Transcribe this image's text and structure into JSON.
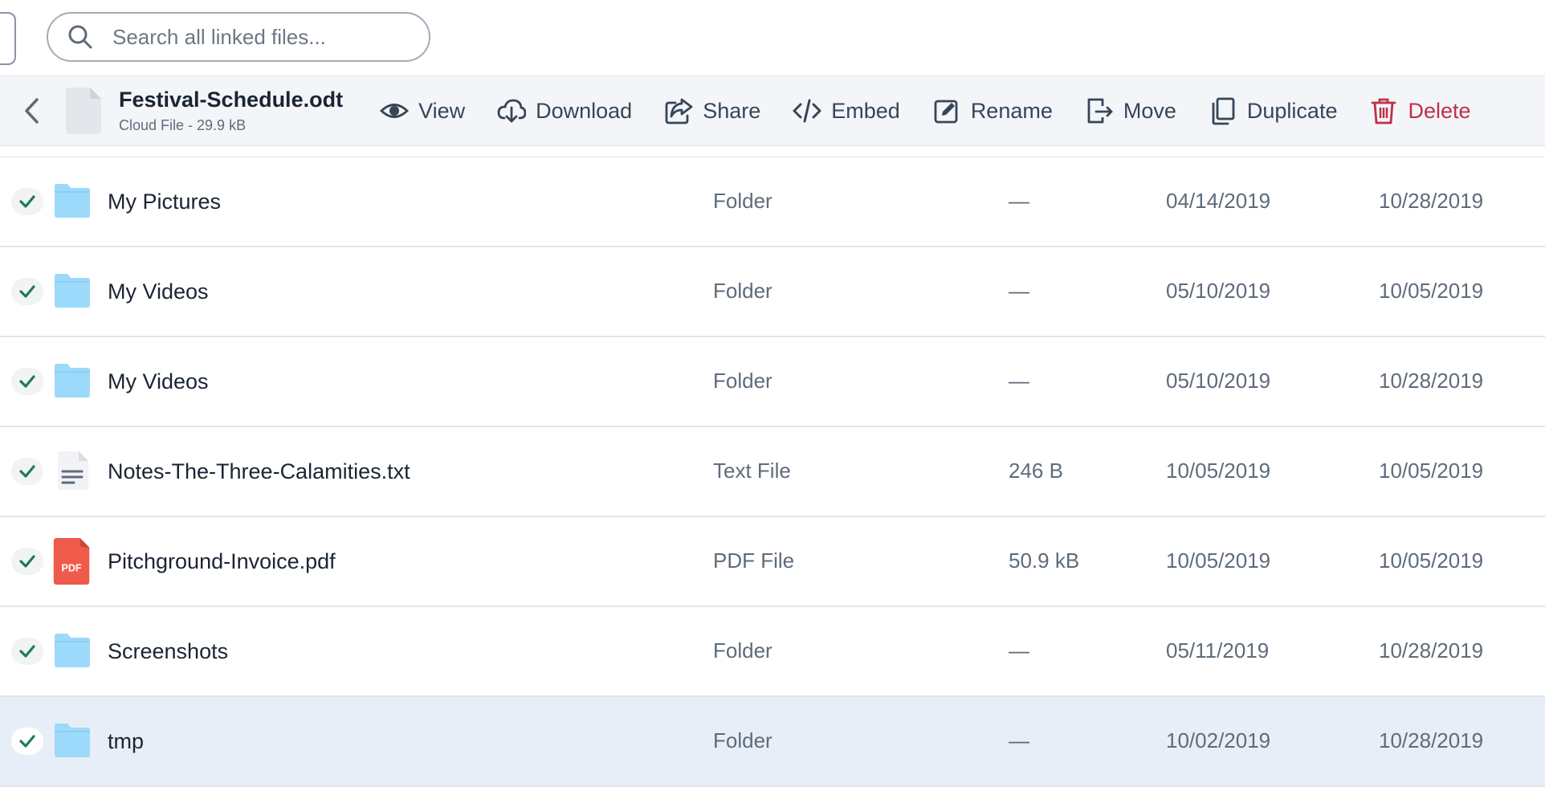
{
  "search": {
    "placeholder": "Search all linked files..."
  },
  "toolbar": {
    "file_name": "Festival-Schedule.odt",
    "file_meta": "Cloud File - 29.9 kB",
    "actions": {
      "view": "View",
      "download": "Download",
      "share": "Share",
      "embed": "Embed",
      "rename": "Rename",
      "move": "Move",
      "duplicate": "Duplicate",
      "delete": "Delete"
    }
  },
  "colors": {
    "accent": "#1f7a5a",
    "folder": "#9dd9fb",
    "pdf": "#ef5b4a",
    "delete": "#c03046",
    "selected_row": "#e8eef7"
  },
  "rows": [
    {
      "name": "My Pictures",
      "type": "Folder",
      "size": "—",
      "created": "04/14/2019",
      "modified": "10/28/2019",
      "icon": "folder-icon"
    },
    {
      "name": "My Videos",
      "type": "Folder",
      "size": "—",
      "created": "05/10/2019",
      "modified": "10/05/2019",
      "icon": "folder-icon"
    },
    {
      "name": "My Videos",
      "type": "Folder",
      "size": "—",
      "created": "05/10/2019",
      "modified": "10/28/2019",
      "icon": "folder-icon"
    },
    {
      "name": "Notes-The-Three-Calamities.txt",
      "type": "Text File",
      "size": "246 B",
      "created": "10/05/2019",
      "modified": "10/05/2019",
      "icon": "text-file-icon"
    },
    {
      "name": "Pitchground-Invoice.pdf",
      "type": "PDF File",
      "size": "50.9 kB",
      "created": "10/05/2019",
      "modified": "10/05/2019",
      "icon": "pdf-file-icon",
      "icon_label": "PDF"
    },
    {
      "name": "Screenshots",
      "type": "Folder",
      "size": "—",
      "created": "05/11/2019",
      "modified": "10/28/2019",
      "icon": "folder-icon"
    },
    {
      "name": "tmp",
      "type": "Folder",
      "size": "—",
      "created": "10/02/2019",
      "modified": "10/28/2019",
      "icon": "folder-icon",
      "selected": true
    }
  ]
}
